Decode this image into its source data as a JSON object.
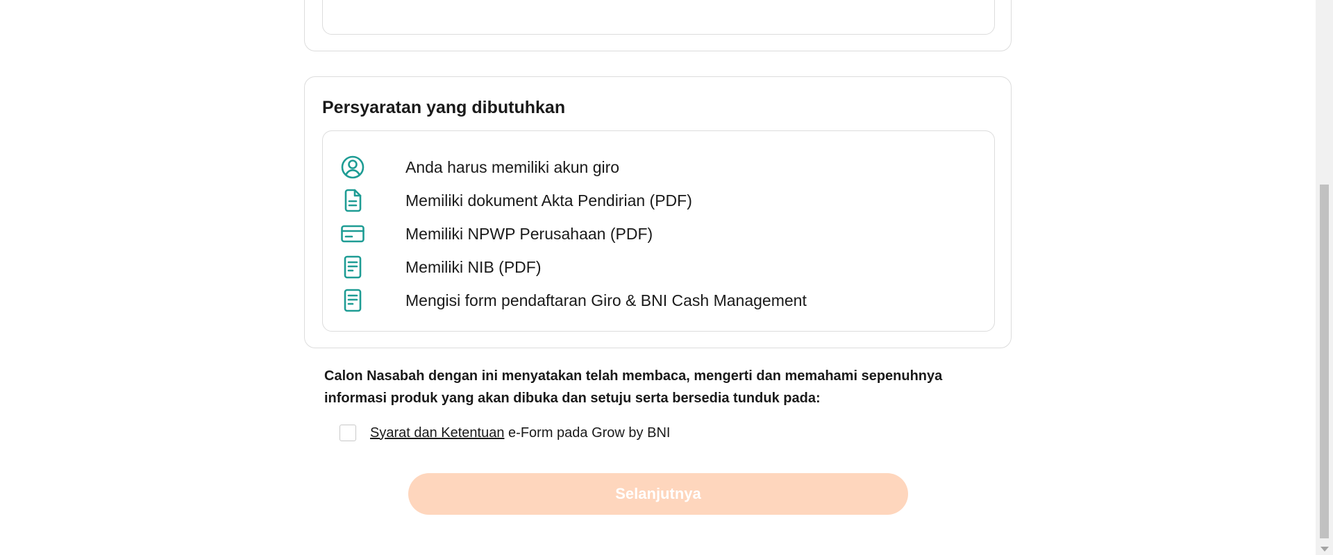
{
  "colors": {
    "accent_teal": "#1e9c94",
    "button_disabled_bg": "#fed6bd",
    "button_text": "#ffffff",
    "border": "#dcdcdc"
  },
  "requirements": {
    "title": "Persyaratan yang dibutuhkan",
    "items": [
      {
        "icon": "user-circle-icon",
        "label": "Anda harus memiliki akun giro"
      },
      {
        "icon": "document-icon",
        "label": "Memiliki dokument Akta Pendirian (PDF)"
      },
      {
        "icon": "card-icon",
        "label": "Memiliki NPWP Perusahaan (PDF)"
      },
      {
        "icon": "file-text-icon",
        "label": "Memiliki NIB (PDF)"
      },
      {
        "icon": "file-text-icon",
        "label": "Mengisi form pendaftaran Giro & BNI Cash Management"
      }
    ]
  },
  "declaration": {
    "text": "Calon Nasabah dengan ini menyatakan telah membaca, mengerti dan memahami sepenuhnya informasi produk yang akan dibuka dan setuju serta bersedia tunduk pada:"
  },
  "agreement": {
    "checked": false,
    "link_label": "Syarat dan Ketentuan",
    "suffix": " e-Form pada Grow by BNI"
  },
  "next_button": {
    "label": "Selanjutnya",
    "disabled": true
  }
}
